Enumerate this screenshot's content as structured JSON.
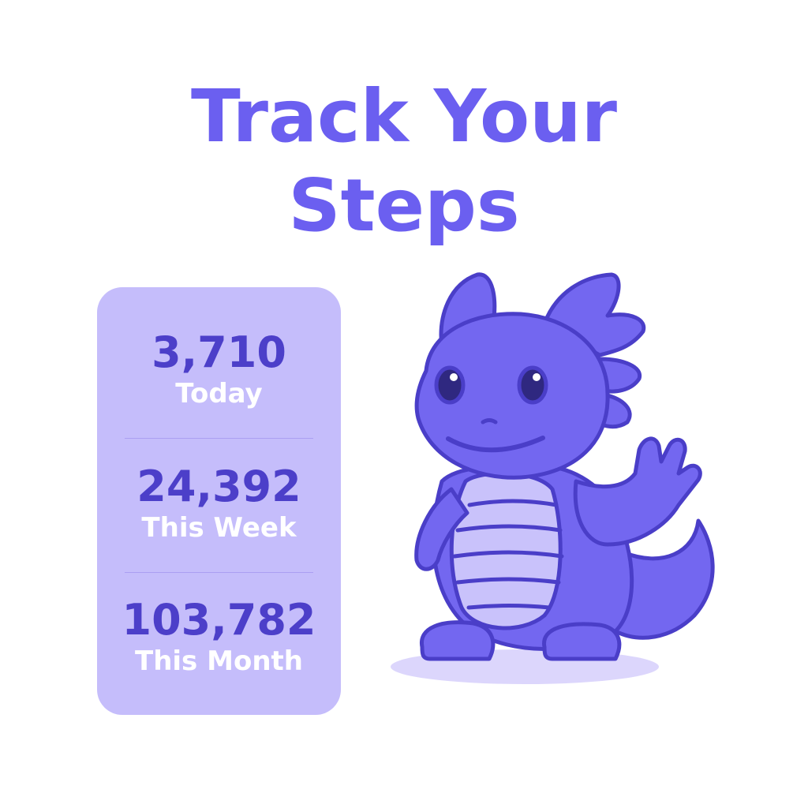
{
  "title": {
    "line1": "Track Your",
    "line2": "Steps"
  },
  "stats": [
    {
      "value": "3,710",
      "label": "Today"
    },
    {
      "value": "24,392",
      "label": "This Week"
    },
    {
      "value": "103,782",
      "label": "This Month"
    }
  ],
  "colors": {
    "accent": "#6b5ff0",
    "card": "#c5bdfb",
    "number": "#4c3fc9",
    "mascot": "#7367f0",
    "belly": "#c9c2fb",
    "outline": "#4a3ec8"
  },
  "mascot": {
    "icon": "dragon-mascot-waving"
  }
}
